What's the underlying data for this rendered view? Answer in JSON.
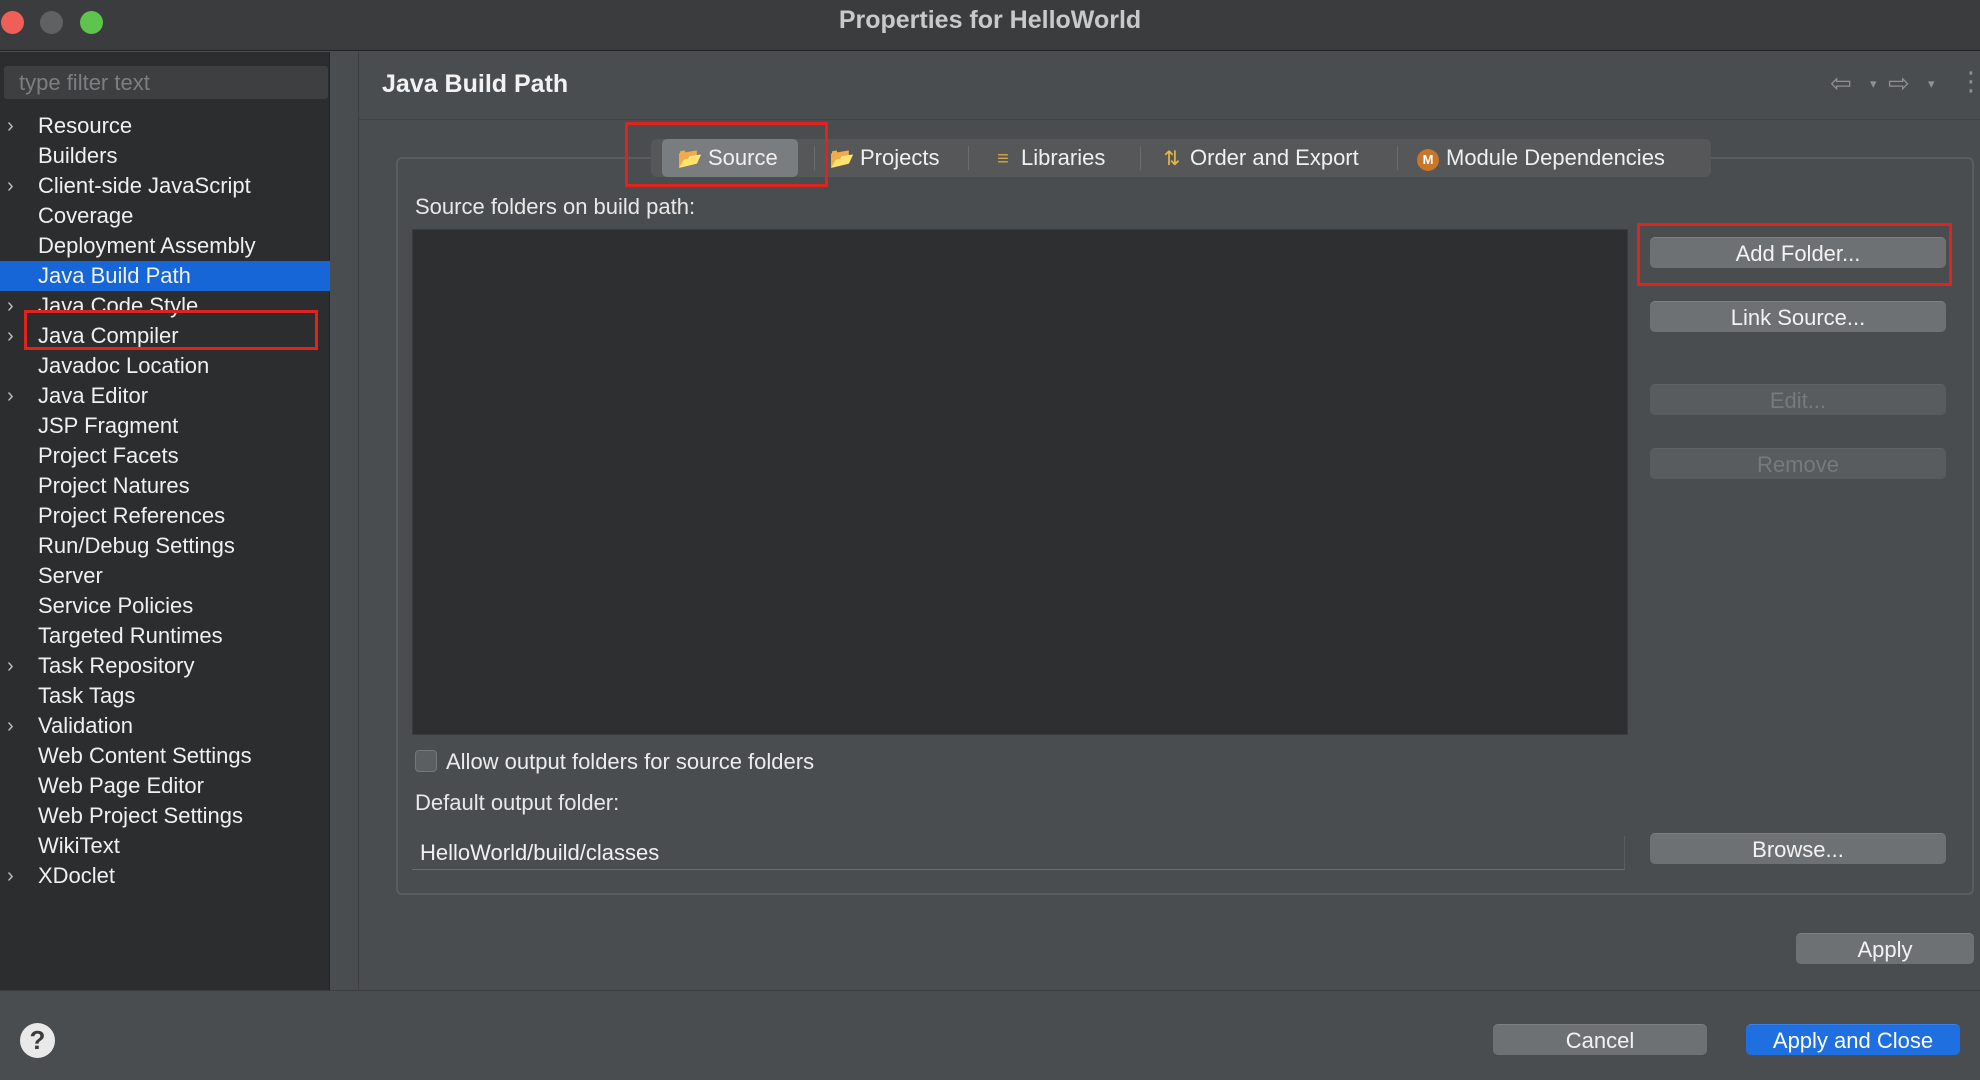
{
  "window": {
    "title": "Properties for HelloWorld"
  },
  "sidebar": {
    "filter_placeholder": "type filter text",
    "items": [
      {
        "label": "Resource",
        "expandable": true
      },
      {
        "label": "Builders",
        "expandable": false
      },
      {
        "label": "Client-side JavaScript",
        "expandable": true
      },
      {
        "label": "Coverage",
        "expandable": false
      },
      {
        "label": "Deployment Assembly",
        "expandable": false
      },
      {
        "label": "Java Build Path",
        "expandable": false,
        "selected": true
      },
      {
        "label": "Java Code Style",
        "expandable": true
      },
      {
        "label": "Java Compiler",
        "expandable": true
      },
      {
        "label": "Javadoc Location",
        "expandable": false
      },
      {
        "label": "Java Editor",
        "expandable": true
      },
      {
        "label": "JSP Fragment",
        "expandable": false
      },
      {
        "label": "Project Facets",
        "expandable": false
      },
      {
        "label": "Project Natures",
        "expandable": false
      },
      {
        "label": "Project References",
        "expandable": false
      },
      {
        "label": "Run/Debug Settings",
        "expandable": false
      },
      {
        "label": "Server",
        "expandable": false
      },
      {
        "label": "Service Policies",
        "expandable": false
      },
      {
        "label": "Targeted Runtimes",
        "expandable": false
      },
      {
        "label": "Task Repository",
        "expandable": true
      },
      {
        "label": "Task Tags",
        "expandable": false
      },
      {
        "label": "Validation",
        "expandable": true
      },
      {
        "label": "Web Content Settings",
        "expandable": false
      },
      {
        "label": "Web Page Editor",
        "expandable": false
      },
      {
        "label": "Web Project Settings",
        "expandable": false
      },
      {
        "label": "WikiText",
        "expandable": false
      },
      {
        "label": "XDoclet",
        "expandable": true
      }
    ]
  },
  "main": {
    "title": "Java Build Path",
    "tabs": [
      {
        "label": "Source",
        "icon": "source-folder-icon",
        "active": true
      },
      {
        "label": "Projects",
        "icon": "projects-folder-icon"
      },
      {
        "label": "Libraries",
        "icon": "libraries-icon"
      },
      {
        "label": "Order and Export",
        "icon": "order-export-icon"
      },
      {
        "label": "Module Dependencies",
        "icon": "module-icon"
      }
    ],
    "source_label": "Source folders on build path:",
    "buttons": {
      "add_folder": "Add Folder...",
      "link_source": "Link Source...",
      "edit": "Edit...",
      "remove": "Remove",
      "browse": "Browse..."
    },
    "allow_output_label": "Allow output folders for source folders",
    "allow_output_checked": false,
    "output_folder_label": "Default output folder:",
    "output_folder_value": "HelloWorld/build/classes"
  },
  "footer": {
    "apply": "Apply",
    "cancel": "Cancel",
    "apply_close": "Apply and Close"
  },
  "colors": {
    "accent": "#1766d8",
    "highlight": "#e0231c",
    "background": "#4a4d50"
  }
}
